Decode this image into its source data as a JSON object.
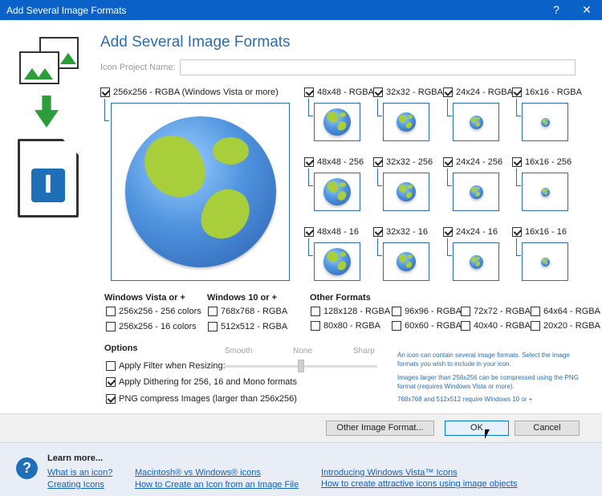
{
  "window": {
    "title": "Add Several Image Formats",
    "help_glyph": "?",
    "close_glyph": "✕"
  },
  "heading": "Add Several Image Formats",
  "project": {
    "label": "Icon Project Name:",
    "value": "",
    "placeholder": ""
  },
  "large": {
    "label": "256x256 - RGBA (Windows Vista or more)",
    "checked": true
  },
  "grid": [
    {
      "label": "48x48 - RGBA",
      "checked": true
    },
    {
      "label": "32x32 - RGBA",
      "checked": true
    },
    {
      "label": "24x24 - RGBA",
      "checked": true
    },
    {
      "label": "16x16 - RGBA",
      "checked": true
    },
    {
      "label": "48x48 - 256",
      "checked": true
    },
    {
      "label": "32x32 - 256",
      "checked": true
    },
    {
      "label": "24x24 - 256",
      "checked": true
    },
    {
      "label": "16x16 - 256",
      "checked": true
    },
    {
      "label": "48x48 - 16",
      "checked": true
    },
    {
      "label": "32x32 - 16",
      "checked": true
    },
    {
      "label": "24x24 - 16",
      "checked": true
    },
    {
      "label": "16x16 - 16",
      "checked": true
    }
  ],
  "vista": {
    "title": "Windows Vista or +",
    "items": [
      {
        "label": "256x256 - 256 colors",
        "checked": false
      },
      {
        "label": "256x256 - 16 colors",
        "checked": false
      }
    ]
  },
  "win10": {
    "title": "Windows 10 or +",
    "items": [
      {
        "label": "768x768 - RGBA",
        "checked": false
      },
      {
        "label": "512x512 - RGBA",
        "checked": false
      }
    ]
  },
  "other": {
    "title": "Other Formats",
    "items": [
      {
        "label": "128x128 - RGBA",
        "checked": false
      },
      {
        "label": "96x96 - RGBA",
        "checked": false
      },
      {
        "label": "72x72 - RGBA",
        "checked": false
      },
      {
        "label": "64x64 - RGBA",
        "checked": false
      },
      {
        "label": "80x80 - RGBA",
        "checked": false
      },
      {
        "label": "60x60 - RGBA",
        "checked": false
      },
      {
        "label": "40x40 - RGBA",
        "checked": false
      },
      {
        "label": "20x20 - RGBA",
        "checked": false
      }
    ]
  },
  "options": {
    "title": "Options",
    "filter": {
      "label": "Apply Filter when Resizing:",
      "checked": false
    },
    "dither": {
      "label": "Apply Dithering for 256, 16 and Mono formats",
      "checked": true
    },
    "png": {
      "label": "PNG compress Images (larger than 256x256)",
      "checked": true
    },
    "slider": {
      "labels": [
        "Smooth",
        "None",
        "Sharp"
      ],
      "value": "None"
    }
  },
  "info": {
    "p1": "An icon can contain several image formats. Select the image formats you wish to include in your icon.",
    "p2": "Images larger than 256x256 can be compressed using the PNG format (requires Windows Vista or more).",
    "p3": "768x768 and 512x512 require Windows 10 or +"
  },
  "buttons": {
    "other": "Other Image Format...",
    "ok": "OK",
    "cancel": "Cancel"
  },
  "learn": {
    "title": "Learn more...",
    "links": [
      "What is an icon?",
      "Creating Icons",
      "Macintosh® vs Windows® icons",
      "How to Create an Icon from an Image File",
      "Introducing Windows Vista™ Icons",
      "How to create attractive icons using image objects"
    ]
  },
  "colors": {
    "titlebar": "#0a62c9",
    "accent": "#2e6da8",
    "link": "#1060c0",
    "globe_land": "#a8cf3b",
    "globe_sea": "#4f93de"
  }
}
